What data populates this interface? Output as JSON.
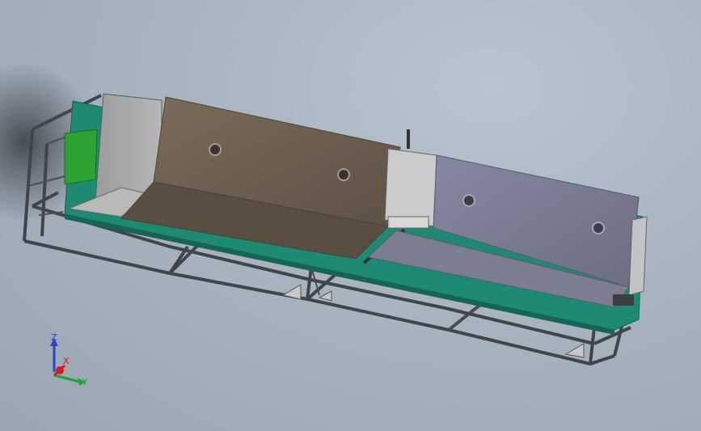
{
  "view": {
    "background_color": "#a9b4c1",
    "model": {
      "frame_color": "#4a4f55",
      "tray_color": "#1f8a73",
      "panel_brown": "#6e6050",
      "panel_blue": "#7d8091",
      "panel_gray": "#9c9ea0",
      "box_light": "#c9cbcc",
      "pcb_green": "#2ea233"
    },
    "triad": {
      "x_label": "X",
      "y_label": "Y",
      "z_label": "Z",
      "x_color": "#d41c1c",
      "y_color": "#22a03a",
      "z_color": "#2b43c8"
    }
  }
}
